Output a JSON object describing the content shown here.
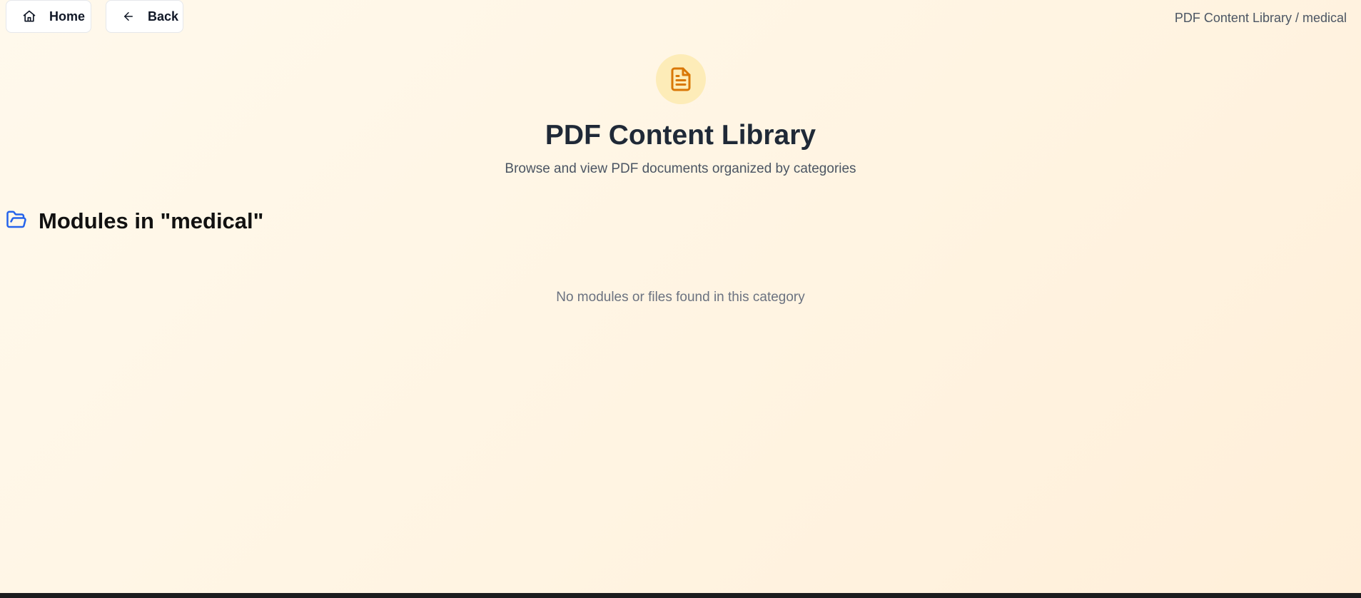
{
  "nav": {
    "home_label": "Home",
    "back_label": "Back"
  },
  "breadcrumb": "PDF Content Library / medical",
  "hero": {
    "title": "PDF Content Library",
    "subtitle": "Browse and view PDF documents organized by categories",
    "icon": "file-text-icon"
  },
  "section": {
    "title": "Modules in \"medical\"",
    "icon": "folder-open-icon"
  },
  "empty_message": "No modules or files found in this category",
  "colors": {
    "accent_orange": "#d97706",
    "accent_blue": "#2563eb",
    "icon_circle": "#fdecb8"
  }
}
